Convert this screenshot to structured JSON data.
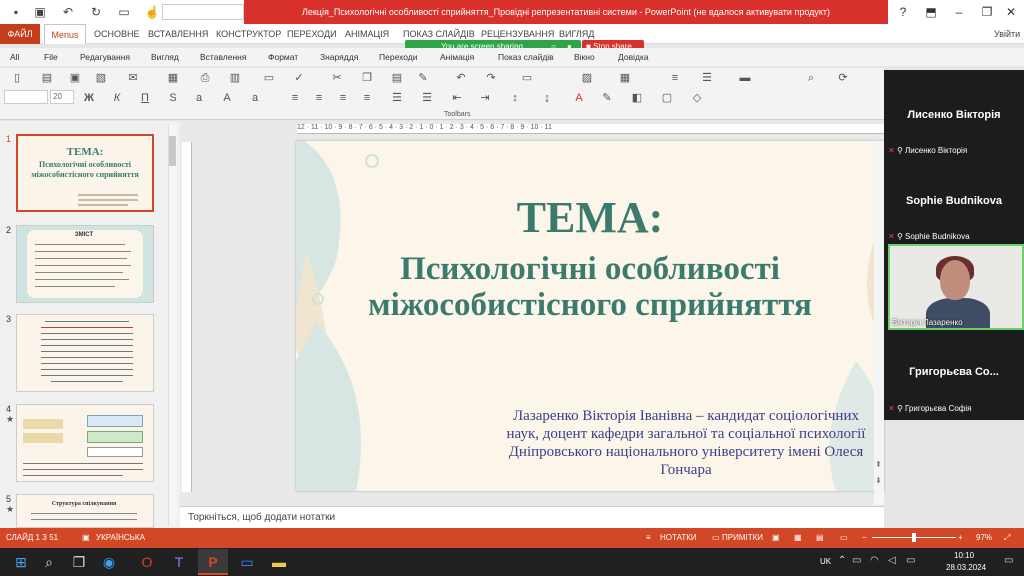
{
  "window": {
    "title": "Лекція_Психологічні особливості сприйняття_Провідні репрезентативні системи  -  PowerPoint (не вдалося активувати продукт)",
    "help_icon": "?",
    "user_signin": "Увійти"
  },
  "ribbon_tabs": {
    "file": "ФАЙЛ",
    "menus": "Menus",
    "home": "ОСНОВНЕ",
    "insert": "ВСТАВЛЕННЯ",
    "design": "КОНСТРУКТОР",
    "transitions": "ПЕРЕХОДИ",
    "animations": "АНІМАЦІЯ",
    "slideshow": "ПОКАЗ СЛАЙДІВ",
    "review": "РЕЦЕНЗУВАННЯ",
    "view": "ВИГЛЯД"
  },
  "sharing": {
    "banner": "You are screen sharing",
    "stop": "Stop share"
  },
  "menus": [
    "All",
    "File",
    "Редагування",
    "Вигляд",
    "Вставлення",
    "Формат",
    "Знаряддя",
    "Переходи",
    "Анімація",
    "Показ слайдів",
    "Вікно",
    "Довідка"
  ],
  "font_size_value": "20",
  "toolbars_label": "Toolbars",
  "ruler_h": "12 · 11 · 10 · 9 · 8 · 7 · 6 · 5 · 4 · 3 · 2 · 1 · 0 · 1 · 2 · 3 · 4 · 5 · 6 · 7 · 8 · 9 · 10 · 11",
  "thumbnails": {
    "numbers": [
      "1",
      "2",
      "3",
      "4",
      "5"
    ],
    "t1_title": "ТЕМА:",
    "t1_sub": "Психологічні особливості міжособистісного сприйняття",
    "t2_title": "ЗМІСТ",
    "t5_title": "Структура спілкування"
  },
  "slide": {
    "title": "ТЕМА:",
    "subtitle": "Психологічні особливості міжособистісного сприйняття",
    "author": "Лазаренко Вікторія Іванівна – кандидат соціологічних наук,  доцент кафедри загальної та соціальної психології Дніпровського національного університету імені Олеся Гончара"
  },
  "notes_placeholder": "Торкніться, щоб додати нотатки",
  "participants": {
    "p1_big": "Лисенко Вікторія",
    "p1_small": "Лисенко Вікторія",
    "p2_big": "Sophie Budnikova",
    "p2_small": "Sophie Budnikova",
    "p3_small": "Вікторія Лазаренко",
    "p4_big": "Григорьєва Со...",
    "p4_small": "Григорьєва Софія"
  },
  "status_bar": {
    "slide_info": "СЛАЙД 1 З 51",
    "language": "УКРАЇНСЬКА",
    "notes": "НОТАТКИ",
    "comments": "ПРИМІТКИ",
    "zoom": "97%"
  },
  "taskbar": {
    "time": "10:10",
    "date": "28.03.2024",
    "lang": "UK"
  },
  "colors": {
    "accent": "#d24726",
    "title_bar": "#d9312b",
    "slide_title": "#3d7a6e",
    "slide_author": "#3b3f8a"
  }
}
